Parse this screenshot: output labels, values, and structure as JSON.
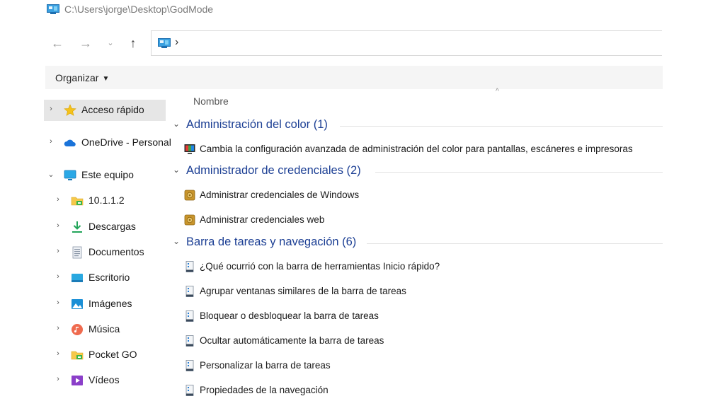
{
  "window": {
    "title": "C:\\Users\\jorge\\Desktop\\GodMode"
  },
  "nav": {
    "back": "←",
    "forward": "→",
    "recent": "⌄",
    "up": "↑",
    "address_separator": "›"
  },
  "toolbar": {
    "organize_label": "Organizar",
    "organize_caret": "▼"
  },
  "sidebar": {
    "items": [
      {
        "label": "Acceso rápido",
        "icon": "star-icon",
        "chevron": "›"
      },
      {
        "label": "OneDrive - Personal",
        "icon": "cloud-icon",
        "chevron": "›"
      },
      {
        "label": "Este equipo",
        "icon": "computer-icon",
        "chevron": "⌄"
      },
      {
        "label": "10.1.1.2",
        "icon": "network-folder-icon",
        "chevron": "›"
      },
      {
        "label": "Descargas",
        "icon": "download-icon",
        "chevron": "›"
      },
      {
        "label": "Documentos",
        "icon": "document-icon",
        "chevron": "›"
      },
      {
        "label": "Escritorio",
        "icon": "desktop-icon",
        "chevron": "›"
      },
      {
        "label": "Imágenes",
        "icon": "pictures-icon",
        "chevron": "›"
      },
      {
        "label": "Música",
        "icon": "music-icon",
        "chevron": "›"
      },
      {
        "label": "Pocket GO",
        "icon": "folder-icon",
        "chevron": "›"
      },
      {
        "label": "Vídeos",
        "icon": "videos-icon",
        "chevron": "›"
      }
    ]
  },
  "content": {
    "column_header": "Nombre",
    "sort_indicator": "^",
    "groups": [
      {
        "title": "Administración del color (1)",
        "chevron": "⌄",
        "items": [
          {
            "label": "Cambia la configuración avanzada de administración del color para pantallas, escáneres e impresoras",
            "icon": "color-management-icon"
          }
        ]
      },
      {
        "title": "Administrador de credenciales (2)",
        "chevron": "⌄",
        "items": [
          {
            "label": "Administrar credenciales de Windows",
            "icon": "credential-icon"
          },
          {
            "label": "Administrar credenciales web",
            "icon": "credential-icon"
          }
        ]
      },
      {
        "title": "Barra de tareas y navegación (6)",
        "chevron": "⌄",
        "items": [
          {
            "label": "¿Qué ocurrió con la barra de herramientas Inicio rápido?",
            "icon": "taskbar-icon"
          },
          {
            "label": "Agrupar ventanas similares de la barra de tareas",
            "icon": "taskbar-icon"
          },
          {
            "label": "Bloquear o desbloquear la barra de tareas",
            "icon": "taskbar-icon"
          },
          {
            "label": "Ocultar automáticamente la barra de tareas",
            "icon": "taskbar-icon"
          },
          {
            "label": "Personalizar la barra de tareas",
            "icon": "taskbar-icon"
          },
          {
            "label": "Propiedades de la navegación",
            "icon": "taskbar-icon"
          }
        ]
      }
    ]
  }
}
